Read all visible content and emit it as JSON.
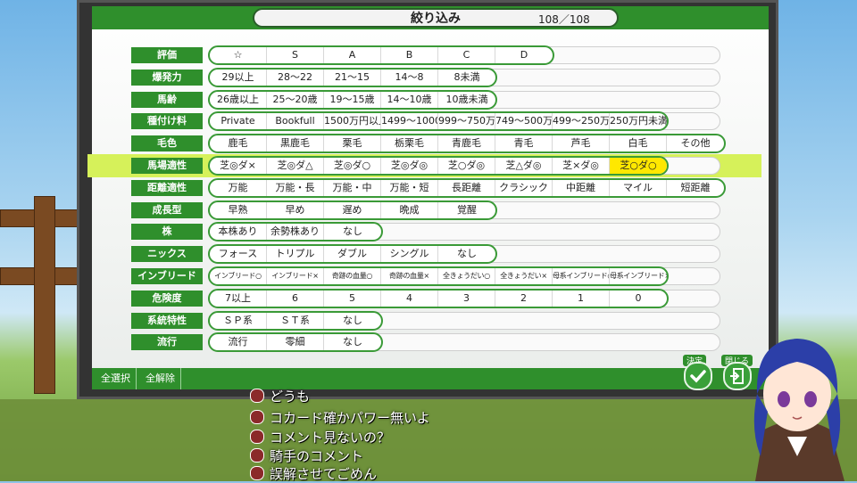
{
  "header": {
    "title": "絞り込み",
    "count": "108／108"
  },
  "footer": {
    "select_all": "全選択",
    "deselect_all": "全解除"
  },
  "actions": {
    "confirm_label": "決定",
    "close_label": "閉じる"
  },
  "filters": [
    {
      "label": "評価",
      "options": [
        "☆",
        "S",
        "A",
        "B",
        "C",
        "D"
      ]
    },
    {
      "label": "爆発力",
      "options": [
        "29以上",
        "28〜22",
        "21〜15",
        "14〜8",
        "8未満"
      ]
    },
    {
      "label": "馬齢",
      "options": [
        "26歳以上",
        "25〜20歳",
        "19〜15歳",
        "14〜10歳",
        "10歳未満"
      ]
    },
    {
      "label": "種付け料",
      "options": [
        "Private",
        "Bookfull",
        "1500万円以上",
        "1499〜1000万",
        "999〜750万",
        "749〜500万",
        "499〜250万",
        "250万円未満"
      ]
    },
    {
      "label": "毛色",
      "options": [
        "鹿毛",
        "黒鹿毛",
        "栗毛",
        "栃栗毛",
        "青鹿毛",
        "青毛",
        "芦毛",
        "白毛",
        "その他"
      ]
    },
    {
      "label": "馬場適性",
      "options": [
        "芝◎ダ×",
        "芝◎ダ△",
        "芝◎ダ○",
        "芝◎ダ◎",
        "芝○ダ◎",
        "芝△ダ◎",
        "芝×ダ◎",
        "芝○ダ○"
      ],
      "selected_index": 7,
      "highlight": true
    },
    {
      "label": "距離適性",
      "options": [
        "万能",
        "万能・長",
        "万能・中",
        "万能・短",
        "長距離",
        "クラシック",
        "中距離",
        "マイル",
        "短距離"
      ]
    },
    {
      "label": "成長型",
      "options": [
        "早熟",
        "早め",
        "遅め",
        "晩成",
        "覚醒"
      ]
    },
    {
      "label": "株",
      "options": [
        "本株あり",
        "余勢株あり",
        "なし"
      ]
    },
    {
      "label": "ニックス",
      "options": [
        "フォース",
        "トリプル",
        "ダブル",
        "シングル",
        "なし"
      ]
    },
    {
      "label": "インブリード",
      "options": [
        "インブリード○",
        "インブリード×",
        "奇跡の血量○",
        "奇跡の血量×",
        "全きょうだい○",
        "全きょうだい×",
        "母系インブリード○",
        "母系インブリード×"
      ],
      "small": true
    },
    {
      "label": "危険度",
      "options": [
        "7以上",
        "6",
        "5",
        "4",
        "3",
        "2",
        "1",
        "0"
      ]
    },
    {
      "label": "系統特性",
      "options": [
        "ＳＰ系",
        "ＳＴ系",
        "なし"
      ]
    },
    {
      "label": "流行",
      "options": [
        "流行",
        "零細",
        "なし"
      ]
    }
  ],
  "chat": [
    "どうも",
    "コカード確かパワー無いよ",
    "コメント見ないの？",
    "騎手のコメント",
    "誤解させてごめん"
  ],
  "colors": {
    "accent_green": "#2f8f2c",
    "highlight_row": "#d6f15a",
    "selected_option": "#ffe800"
  }
}
